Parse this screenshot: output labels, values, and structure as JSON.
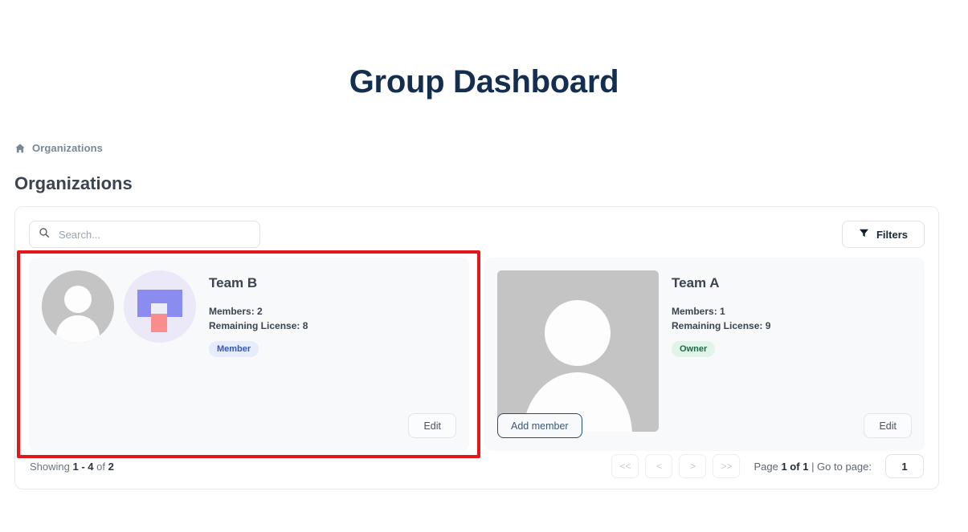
{
  "header": {
    "title": "Group Dashboard"
  },
  "breadcrumb": {
    "icon": "home-icon",
    "label": "Organizations"
  },
  "section": {
    "heading": "Organizations"
  },
  "toolbar": {
    "search": {
      "icon": "search-icon",
      "value": "",
      "placeholder": "Search..."
    },
    "filters": {
      "icon": "filter-funnel-icon",
      "label": "Filters"
    }
  },
  "cards": [
    {
      "name": "Team B",
      "members_label": "Members: 2",
      "license_label": "Remaining License: 8",
      "role": "Member",
      "role_kind": "member",
      "avatars": [
        "person-placeholder-avatar",
        "geometric-logo-avatar"
      ],
      "edit_label": "Edit",
      "add_member_label": null
    },
    {
      "name": "Team A",
      "members_label": "Members: 1",
      "license_label": "Remaining License: 9",
      "role": "Owner",
      "role_kind": "owner",
      "avatars": [
        "person-placeholder-avatar-large"
      ],
      "edit_label": "Edit",
      "add_member_label": "Add member"
    }
  ],
  "footer": {
    "showing_prefix": "Showing",
    "showing_range": "1 - 4",
    "showing_of": "of",
    "showing_total": "2",
    "pager": {
      "first": "<<",
      "prev": "<",
      "next": ">",
      "last": ">>",
      "page_prefix": "Page",
      "page_current": "1 of 1",
      "goto_label": "| Go to page:",
      "goto_value": "1"
    }
  },
  "annotation": {
    "highlight_color": "#e3171b",
    "target": "Team B card"
  },
  "colors": {
    "title": "#132e4e",
    "member_badge_bg": "#e6ecfb",
    "member_badge_fg": "#3358b8",
    "owner_badge_bg": "#e1f4ea",
    "owner_badge_fg": "#1c6b47",
    "card_bg": "#f7f9fb"
  }
}
